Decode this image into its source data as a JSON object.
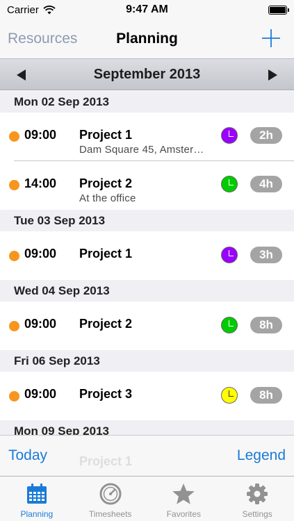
{
  "status_bar": {
    "carrier": "Carrier",
    "time": "9:47 AM"
  },
  "nav": {
    "back_label": "Resources",
    "title": "Planning",
    "add_icon": "plus-icon"
  },
  "month": {
    "title": "September 2013",
    "prev_icon": "triangle-left-icon",
    "next_icon": "triangle-right-icon"
  },
  "colors": {
    "accent": "#1a7bd6",
    "status_dot": "#f7961e",
    "badge": "#a4a4a4",
    "purple": "#9900ff",
    "green": "#00cc00",
    "yellow": "#ffff00"
  },
  "days": [
    {
      "header": "Mon 02 Sep 2013",
      "rows": [
        {
          "time": "09:00",
          "project": "Project 1",
          "address": "Dam Square 45, Amster…",
          "clock_color": "#9900ff",
          "duration": "2h"
        },
        {
          "time": "14:00",
          "project": "Project 2",
          "address": "At the office",
          "clock_color": "#00cc00",
          "duration": "4h"
        }
      ]
    },
    {
      "header": "Tue 03 Sep 2013",
      "rows": [
        {
          "time": "09:00",
          "project": "Project 1",
          "address": "",
          "clock_color": "#9900ff",
          "duration": "3h"
        }
      ]
    },
    {
      "header": "Wed 04 Sep 2013",
      "rows": [
        {
          "time": "09:00",
          "project": "Project 2",
          "address": "",
          "clock_color": "#00cc00",
          "duration": "8h"
        }
      ]
    },
    {
      "header": "Fri 06 Sep 2013",
      "rows": [
        {
          "time": "09:00",
          "project": "Project 3",
          "address": "",
          "clock_color": "#ffff00",
          "duration": "8h"
        }
      ]
    },
    {
      "header": "Mon 09 Sep 2013",
      "rows": []
    }
  ],
  "toolbar": {
    "today_label": "Today",
    "legend_label": "Legend",
    "ghost_text": "Project 1"
  },
  "tabs": [
    {
      "label": "Planning",
      "icon": "calendar-icon",
      "active": true
    },
    {
      "label": "Timesheets",
      "icon": "clock-icon",
      "active": false
    },
    {
      "label": "Favorites",
      "icon": "star-icon",
      "active": false
    },
    {
      "label": "Settings",
      "icon": "gear-icon",
      "active": false
    }
  ]
}
